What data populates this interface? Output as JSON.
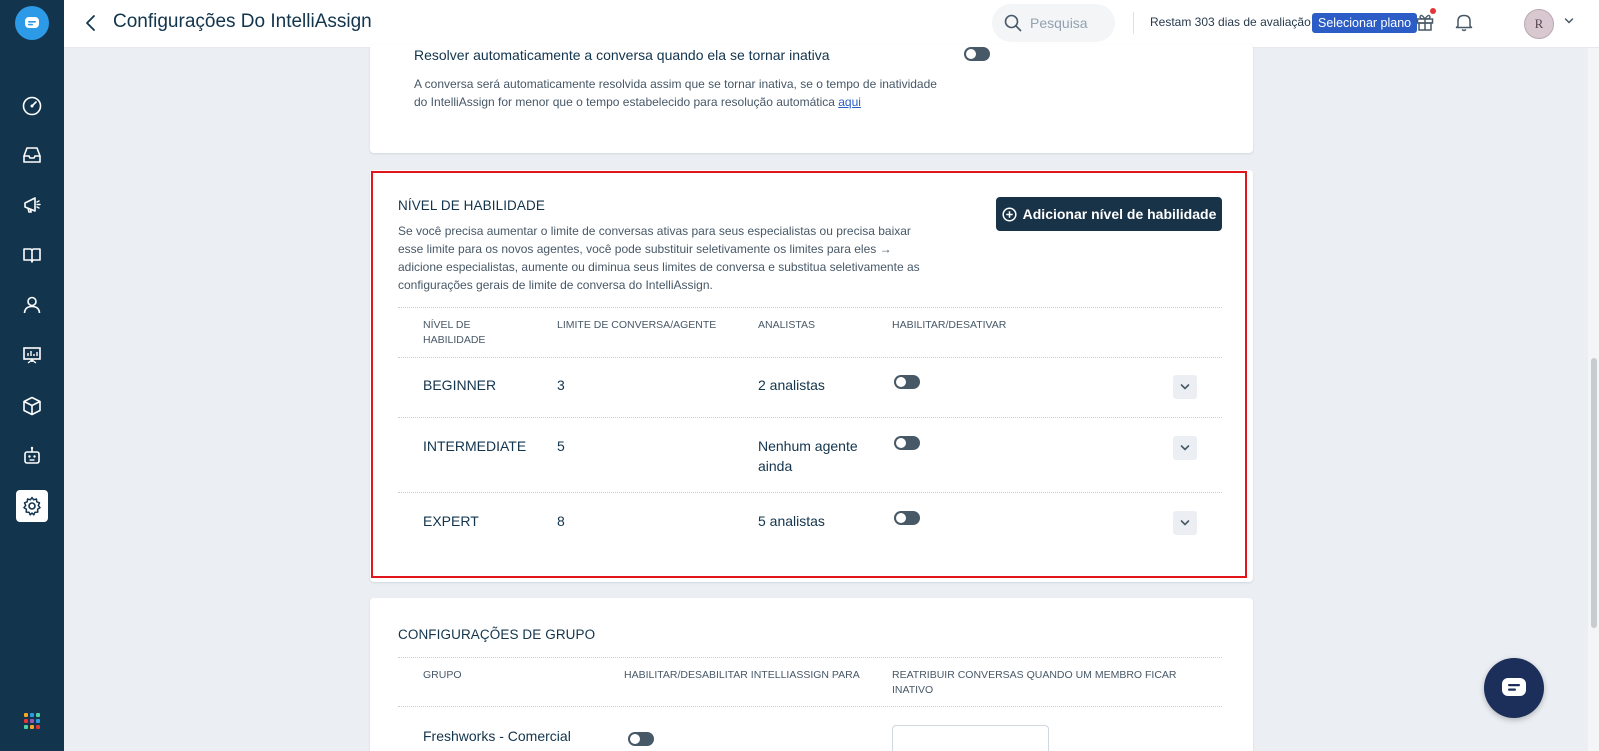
{
  "header": {
    "title": "Configurações Do IntelliAssign",
    "search_placeholder": "Pesquisa",
    "trial_text": "Restam 303 dias de avaliação",
    "plan_button": "Selecionar plano",
    "avatar_initial": "R"
  },
  "auto_resolve": {
    "label": "Resolver automaticamente a conversa quando ela se tornar inativa",
    "description": "A conversa será automaticamente resolvida assim que se tornar inativa, se o tempo de inatividade do IntelliAssign for menor que o tempo estabelecido para resolução automática ",
    "link": "aqui"
  },
  "skill_level": {
    "title": "NÍVEL DE HABILIDADE",
    "description": "Se você precisa aumentar o limite de conversas ativas para seus especialistas ou precisa baixar esse limite para os novos agentes, você pode substituir seletivamente os limites para eles → adicione especialistas, aumente ou diminua seus limites de conversa e substitua seletivamente as configurações gerais de limite de conversa do IntelliAssign.",
    "add_button": "Adicionar nível de habilidade",
    "columns": [
      "NÍVEL DE HABILIDADE",
      "LIMITE DE CONVERSA/AGENTE",
      "ANALISTAS",
      "HABILITAR/DESATIVAR"
    ],
    "rows": [
      {
        "name": "BEGINNER",
        "limit": "3",
        "analysts": "2 analistas"
      },
      {
        "name": "INTERMEDIATE",
        "limit": "5",
        "analysts": "Nenhum agente ainda"
      },
      {
        "name": "EXPERT",
        "limit": "8",
        "analysts": "5 analistas"
      }
    ]
  },
  "group_settings": {
    "title": "CONFIGURAÇÕES DE GRUPO",
    "columns": [
      "GRUPO",
      "HABILITAR/DESABILITAR INTELLIASSIGN PARA",
      "REATRIBUIR CONVERSAS QUANDO UM MEMBRO FICAR INATIVO"
    ],
    "first_group": "Freshworks - Comercial"
  },
  "colors": {
    "sidebar": "#12344d",
    "accent": "#2c5cc5",
    "primary_button": "#183247",
    "highlight": "#e0161c"
  }
}
